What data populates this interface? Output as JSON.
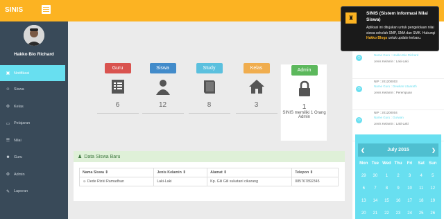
{
  "header": {
    "brand": "SINIS"
  },
  "sidebar": {
    "user": "Hakko Bio Richard",
    "items": [
      {
        "label": "Notifikasi",
        "icon": "dashboard-icon",
        "active": true
      },
      {
        "label": "Siswa",
        "icon": "user-icon"
      },
      {
        "label": "Kelas",
        "icon": "cogs-icon"
      },
      {
        "label": "Pelajaran",
        "icon": "book-icon"
      },
      {
        "label": "Nilai",
        "icon": "tasks-icon"
      },
      {
        "label": "Guru",
        "icon": "users-icon"
      },
      {
        "label": "Admin",
        "icon": "settings-icon"
      },
      {
        "label": "Laporan",
        "icon": "edit-icon"
      }
    ]
  },
  "stats": [
    {
      "label": "Guru",
      "value": "6",
      "color": "#d9534f",
      "icon": "list-icon"
    },
    {
      "label": "Siswa",
      "value": "12",
      "color": "#428bca",
      "icon": "user-icon"
    },
    {
      "label": "Study",
      "value": "8",
      "color": "#5bc0de",
      "icon": "book-icon"
    },
    {
      "label": "Kelas",
      "value": "3",
      "color": "#f0ad4e",
      "icon": "home-icon"
    },
    {
      "label": "Admin",
      "value": "1",
      "color": "#5cb85c",
      "icon": "lock-icon"
    }
  ],
  "admin_note": "SINIS memiliki 1 Orang Admin",
  "panel": {
    "title": "Data Siswa Baru",
    "columns": [
      "Nama Siswa",
      "Jenis Kelamin",
      "Alamat",
      "Telepon"
    ],
    "rows": [
      [
        "Dede Rizki Ramadhan",
        "Laki-Laki",
        "Kp. Gili Gili sukatani cikarang",
        "085767892345"
      ]
    ]
  },
  "recent": [
    {
      "nip": "NP : 201500007",
      "name": "Name Guru : Hakko Bio Richard",
      "gender": "Jenis Kelamin : Laki-Laki"
    },
    {
      "nip": "NIP : 201200003",
      "name": "Name Guru : Dewkan Utaarath",
      "gender": "Jenis Kelamin : Perempuan"
    },
    {
      "nip": "NIP : 201200004",
      "name": "Name Guru : Gurwan",
      "gender": "Jenis Kelamin : Laki-Laki"
    }
  ],
  "calendar": {
    "month": "July 2015",
    "prev": "❮",
    "next": "❯",
    "days": [
      "Mon",
      "Tue",
      "Wed",
      "Thu",
      "Fri",
      "Sat",
      "Sun"
    ],
    "weeks": [
      [
        "29",
        "30",
        "1",
        "2",
        "3",
        "4",
        "5"
      ],
      [
        "6",
        "7",
        "8",
        "9",
        "10",
        "11",
        "12"
      ],
      [
        "13",
        "14",
        "15",
        "16",
        "17",
        "18",
        "19"
      ],
      [
        "20",
        "21",
        "22",
        "23",
        "24",
        "25",
        "26"
      ]
    ]
  },
  "popup": {
    "title": "SINIS (Sistem Informasi Nilai Siswa)",
    "body": "Aplikasi ini ditujukan untuk pengelolaan nilai siswa sekolah SMP, SMA dan SMK. Hubungi",
    "link": "Hakko Blogs",
    "tail": "untuk update terbaru."
  }
}
